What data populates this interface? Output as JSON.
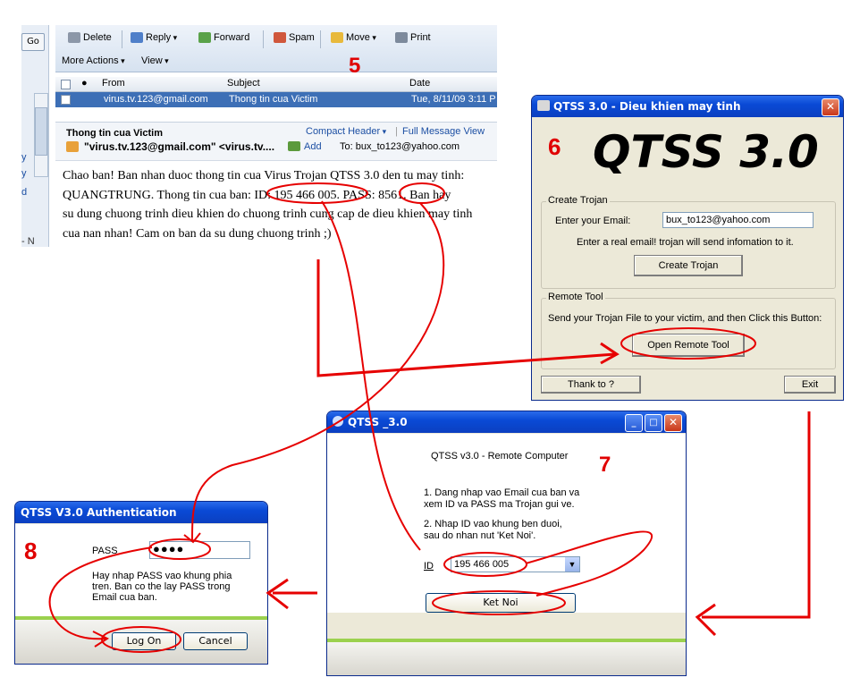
{
  "mail": {
    "go_label": "Go",
    "side_links": [
      "y",
      "y",
      "d",
      "- N"
    ],
    "toolbar": {
      "delete": "Delete",
      "reply": "Reply",
      "forward": "Forward",
      "spam": "Spam",
      "move": "Move",
      "print": "Print",
      "more_actions": "More Actions",
      "view": "View"
    },
    "step_label": "5",
    "columns": {
      "from": "From",
      "subject": "Subject",
      "date": "Date"
    },
    "message_row": {
      "from": "virus.tv.123@gmail.com",
      "subject": "Thong tin cua Victim",
      "date": "Tue, 8/11/09 3:11 P"
    },
    "preview": {
      "subject": "Thong tin cua Victim",
      "compact_header": "Compact Header",
      "full_message_view": "Full Message View",
      "sender": "\"virus.tv.123@gmail.com\" <virus.tv....",
      "add": "Add",
      "to": "To:  bux_to123@yahoo.com"
    },
    "body_lines": [
      "Chao ban! Ban nhan duoc thong tin cua Virus Trojan QTSS 3.0 den tu may tinh:",
      "QUANGTRUNG. Thong tin cua ban: ID: 195 466 005. PASS: 8561. Ban hay",
      "su dung chuong trinh dieu khien do chuong trinh cung cap de dieu khien may tinh",
      "cua nan nhan! Cam on ban da su dung chuong trinh ;)"
    ]
  },
  "qtss_main": {
    "title": "QTSS 3.0 - Dieu khien may tinh",
    "step_label": "6",
    "logo": "QTSS 3.0",
    "create_group": "Create Trojan",
    "email_label": "Enter your Email:",
    "email_value": "bux_to123@yahoo.com",
    "hint": "Enter a real email! trojan will send infomation to it.",
    "create_button": "Create Trojan",
    "remote_group": "Remote Tool",
    "remote_hint": "Send your Trojan File to your victim, and then Click this Button:",
    "open_button": "Open Remote Tool",
    "thanks_button": "Thank to ?",
    "exit_button": "Exit"
  },
  "remote": {
    "title": "QTSS _3.0",
    "heading": "QTSS v3.0 - Remote Computer",
    "step_label": "7",
    "instr1": [
      "1. Dang nhap vao Email cua ban va",
      "xem ID va PASS ma Trojan gui ve."
    ],
    "instr2": [
      "2. Nhap ID vao khung ben duoi,",
      "sau do nhan nut 'Ket Noi'."
    ],
    "id_label": "ID",
    "id_value": "195 466 005",
    "connect_button": "Ket Noi"
  },
  "auth": {
    "title": "QTSS V3.0 Authentication",
    "step_label": "8",
    "pass_label": "PASS",
    "pass_value": "●●●●",
    "message": [
      "Hay nhap PASS vao khung phia",
      "tren. Ban co the lay PASS trong",
      "Email cua ban."
    ],
    "logon_button": "Log On",
    "cancel_button": "Cancel"
  },
  "colors": {
    "annotation": "#e60000",
    "xp_title": "#0a4ad6",
    "selection": "#3d6fb6"
  }
}
